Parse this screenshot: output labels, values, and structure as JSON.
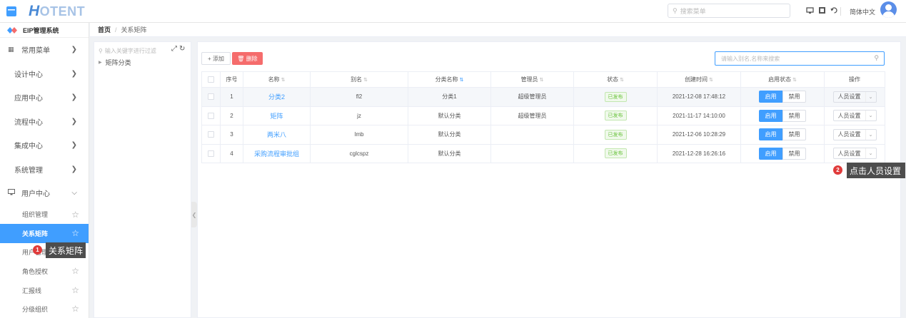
{
  "header": {
    "logo_h": "H",
    "logo_rest": "OTENT",
    "search_placeholder": "搜索菜单",
    "language": "简体中文"
  },
  "sidebar": {
    "system_title": "EIP管理系统",
    "items": [
      {
        "label": "常用菜单"
      },
      {
        "label": "设计中心"
      },
      {
        "label": "应用中心"
      },
      {
        "label": "流程中心"
      },
      {
        "label": "集成中心"
      },
      {
        "label": "系统管理"
      },
      {
        "label": "用户中心"
      }
    ],
    "sub_items": [
      {
        "label": "组织管理"
      },
      {
        "label": "关系矩阵"
      },
      {
        "label": "用户管理"
      },
      {
        "label": "角色授权"
      },
      {
        "label": "汇报线"
      },
      {
        "label": "分级组织"
      }
    ]
  },
  "breadcrumb": {
    "home": "首页",
    "separator": "/",
    "current": "关系矩阵"
  },
  "tree": {
    "search_placeholder": "输入关键字进行过滤",
    "root_label": "矩阵分类"
  },
  "toolbar": {
    "add_label": "添加",
    "delete_label": "删除",
    "search_placeholder": "请输入别名,名称来搜索"
  },
  "table": {
    "headers": [
      "序号",
      "名称",
      "别名",
      "分类名称",
      "管理员",
      "状态",
      "创建时间",
      "启用状态",
      "操作"
    ],
    "enable_label": "启用",
    "disable_label": "禁用",
    "op_label": "人员设置",
    "rows": [
      {
        "index": "1",
        "name": "分类2",
        "alias": "fl2",
        "category": "分类1",
        "admin": "超级管理员",
        "status": "已发布",
        "created": "2021-12-08 17:48:12"
      },
      {
        "index": "2",
        "name": "矩阵",
        "alias": "jz",
        "category": "默认分类",
        "admin": "超级管理员",
        "status": "已发布",
        "created": "2021-11-17 14:10:00"
      },
      {
        "index": "3",
        "name": "两米八",
        "alias": "lmb",
        "category": "默认分类",
        "admin": "",
        "status": "已发布",
        "created": "2021-12-06 10:28:29"
      },
      {
        "index": "4",
        "name": "采购流程审批组",
        "alias": "cglcspz",
        "category": "默认分类",
        "admin": "",
        "status": "已发布",
        "created": "2021-12-28 16:26:16"
      }
    ]
  },
  "annotations": {
    "step1_num": "1",
    "step1_text": "关系矩阵",
    "step2_num": "2",
    "step2_text": "点击人员设置"
  },
  "colors": {
    "accent": "#409eff",
    "danger": "#f56c6c",
    "success": "#67c23a"
  }
}
